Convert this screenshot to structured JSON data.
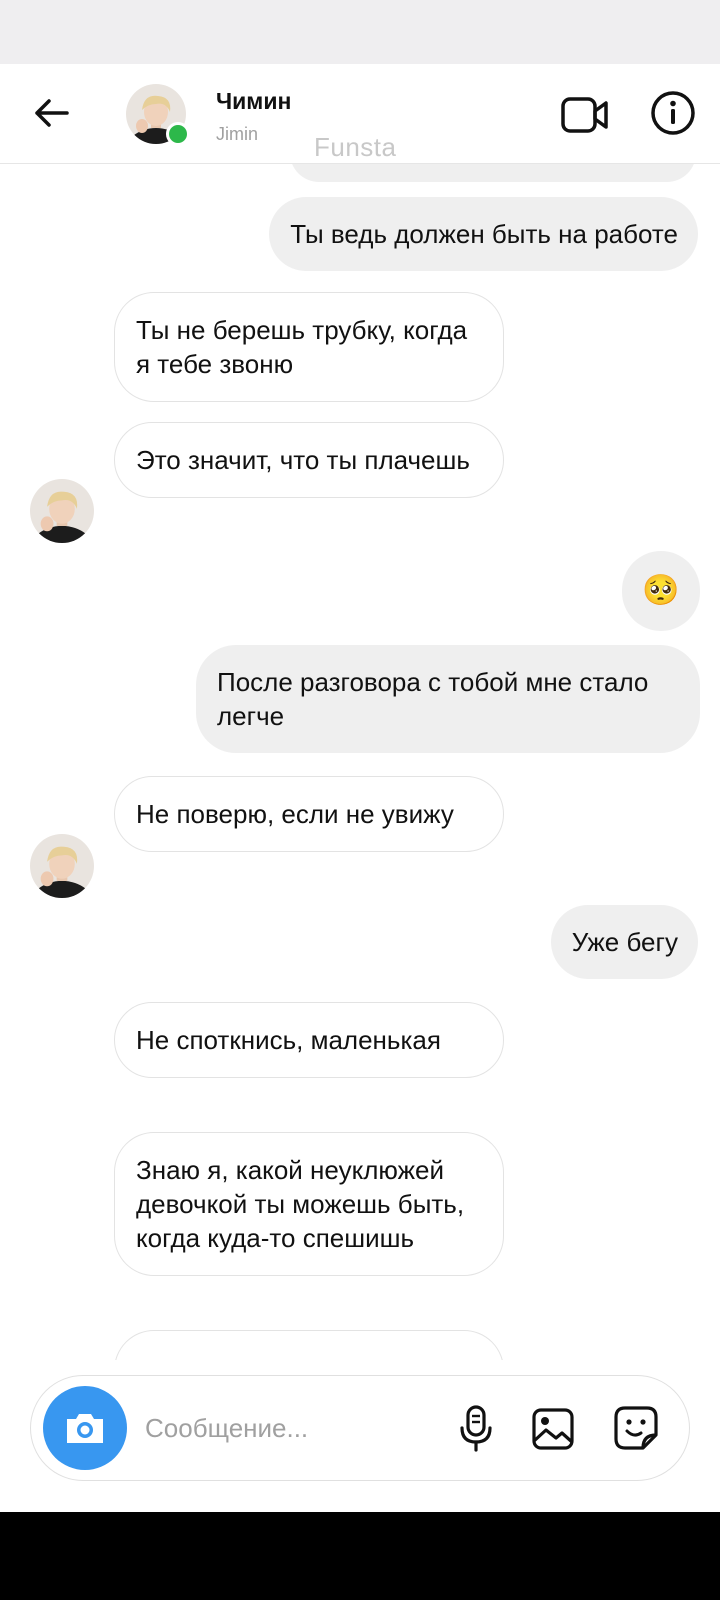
{
  "header": {
    "name": "Чимин",
    "username": "Jimin",
    "watermark": "Funsta"
  },
  "messages": [
    {
      "side": "out",
      "text": "Ты ведь должен быть на работе"
    },
    {
      "side": "in",
      "text": "Ты не берешь трубку, когда я тебе звоню"
    },
    {
      "side": "in",
      "text": "Это значит, что ты плачешь"
    },
    {
      "side": "out",
      "text": "🥺"
    },
    {
      "side": "out",
      "text": "После разговора с тобой мне стало легче"
    },
    {
      "side": "in",
      "text": "Не поверю, если не увижу"
    },
    {
      "side": "out",
      "text": "Уже бегу"
    },
    {
      "side": "in",
      "text": "Не споткнись, маленькая"
    },
    {
      "side": "in",
      "text": "Знаю я, какой неуклюжей девочкой ты можешь быть, когда куда-то спешишь"
    }
  ],
  "composer": {
    "placeholder": "Сообщение..."
  },
  "colors": {
    "camera_button": "#3897f0",
    "online_dot": "#2db84a",
    "outgoing_bubble": "#efefef",
    "incoming_border": "#e3e3e3"
  },
  "icons": [
    "back-arrow-icon",
    "video-call-icon",
    "info-icon",
    "camera-icon",
    "microphone-icon",
    "gallery-icon",
    "sticker-icon"
  ]
}
